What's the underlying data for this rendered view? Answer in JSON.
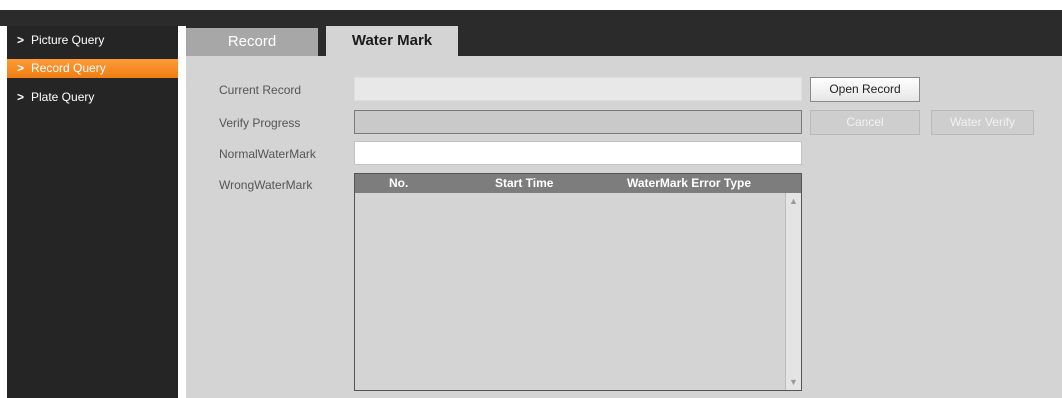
{
  "sidebar": {
    "items": [
      {
        "label": "Picture Query",
        "chevron": ">"
      },
      {
        "label": "Record Query",
        "chevron": ">",
        "active": true
      },
      {
        "label": "Plate Query",
        "chevron": ">"
      }
    ]
  },
  "tabs": [
    {
      "label": "Record"
    },
    {
      "label": "Water Mark",
      "active": true
    }
  ],
  "form": {
    "current_record_label": "Current Record",
    "current_record_value": "",
    "verify_progress_label": "Verify Progress",
    "verify_progress_value": 0,
    "normal_watermark_label": "NormalWaterMark",
    "normal_watermark_value": "",
    "wrong_watermark_label": "WrongWaterMark"
  },
  "buttons": {
    "open_record": "Open Record",
    "cancel": "Cancel",
    "water_verify": "Water Verify"
  },
  "table": {
    "columns": [
      "No.",
      "Start Time",
      "WaterMark Error Type"
    ],
    "rows": []
  },
  "colors": {
    "accent": "#f58a1f",
    "sidebar_bg": "#252525",
    "panel_bg": "#d4d4d4"
  }
}
